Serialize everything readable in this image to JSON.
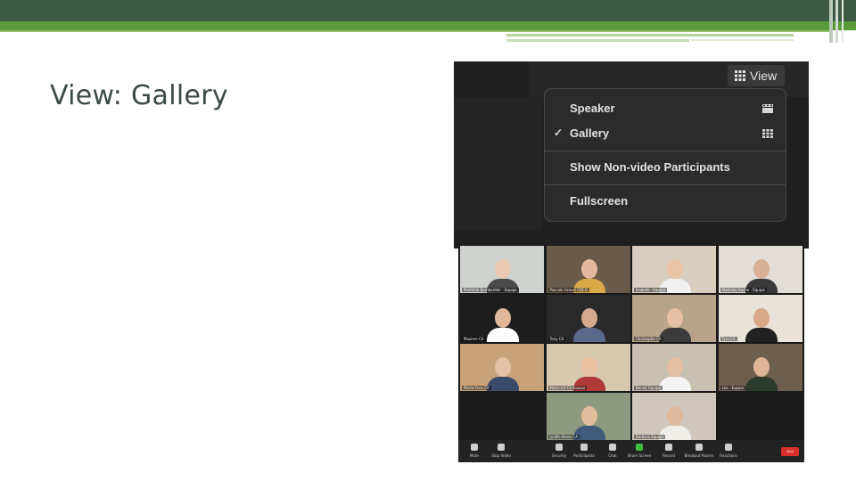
{
  "slide": {
    "title": "View: Gallery"
  },
  "colors": {
    "header_dark": "#3d5a45",
    "header_green": "#5a9a3a",
    "end_button": "#d9302c",
    "active_speaker_outline": "#7fbf3f"
  },
  "view_menu": {
    "button_label": "View",
    "button_icon": "grid-icon",
    "items": [
      {
        "label": "Speaker",
        "checked": false,
        "icon": "speaker-view-icon"
      },
      {
        "label": "Gallery",
        "checked": true,
        "check_mark": "✓",
        "icon": "gallery-grid-icon"
      },
      {
        "label": "Show Non-video Participants",
        "checked": false
      },
      {
        "label": "Fullscreen",
        "checked": false
      }
    ]
  },
  "gallery": {
    "participants": [
      "Mathilde Bombardier - Equipe",
      "Pascale Gravel CDCO",
      "Isabelle - Equipe",
      "Mathilde Roche - Equipe",
      "Maxime CA",
      "Tony CA",
      "Christophe CA",
      "Tyra CA",
      "Pierre-Yves CA",
      "Marie-Lili CA Equipe",
      "Benoit Equipe",
      "Léa - Equipe",
      "",
      "Judith-Alexis CA",
      "Barbara Equipe",
      ""
    ],
    "toolbar": [
      "Mute",
      "Stop Video",
      "Security",
      "Participants",
      "Chat",
      "Share Screen",
      "Record",
      "Breakout Rooms",
      "Reactions"
    ],
    "end_label": "End"
  }
}
